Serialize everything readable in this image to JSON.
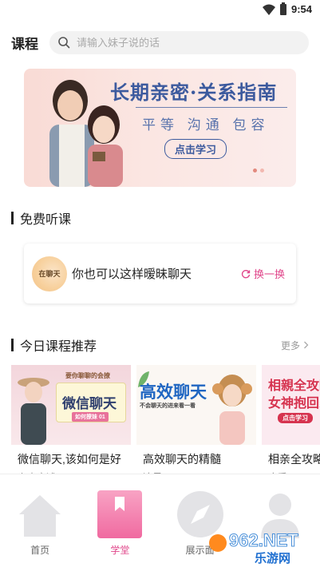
{
  "status": {
    "time": "9:54"
  },
  "header": {
    "title": "课程",
    "search_placeholder": "请输入妹子说的话"
  },
  "banner": {
    "title": "长期亲密·关系指南",
    "subtitle": "平等 沟通 包容",
    "cta": "点击学习",
    "page_count": 2,
    "active_page": 1
  },
  "free_section": {
    "title": "免费听课",
    "card": {
      "thumb_text": "在聊天",
      "text": "你也可以这样暧昧聊天",
      "swap_label": "换一换"
    }
  },
  "today_section": {
    "title": "今日课程推荐",
    "more_label": "更多",
    "courses": [
      {
        "title": "微信聊天,该如何是好",
        "subtitle": "上内变述",
        "thumb_text": "微信聊天",
        "thumb_small": "要你聊聊的会撩",
        "thumb_tag": "如何撩妹 01"
      },
      {
        "title": "高效聊天的精髓",
        "subtitle": "追尽",
        "thumb_text": "高效聊天",
        "thumb_small": "不会聊天的进来看一看"
      },
      {
        "title": "相亲全攻略",
        "subtitle": "应受",
        "thumb_text": "相親全攻略",
        "thumb_text2": "女神抱回家",
        "thumb_tag": "点击学习"
      }
    ]
  },
  "bottom_nav": {
    "items": [
      {
        "label": "首页",
        "icon": "home-icon"
      },
      {
        "label": "学堂",
        "icon": "book-icon"
      },
      {
        "label": "展示面",
        "icon": "compass-icon"
      },
      {
        "label": "",
        "icon": "profile-icon"
      }
    ],
    "active": 1
  },
  "watermark": {
    "text": "962.NET",
    "sub": "乐游网"
  },
  "colors": {
    "accent": "#e0468a",
    "banner_blue": "#3c5a9e"
  }
}
